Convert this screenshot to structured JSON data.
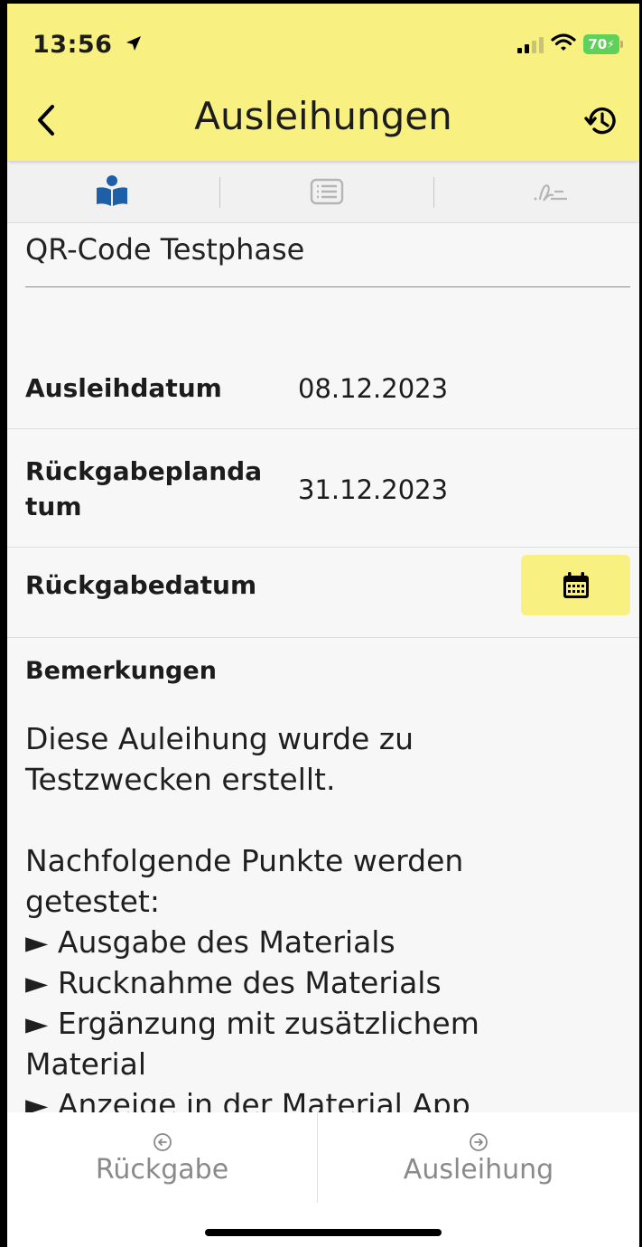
{
  "status_bar": {
    "time": "13:56",
    "battery": "70"
  },
  "header": {
    "title": "Ausleihungen"
  },
  "tabs": [
    {
      "icon": "reader-icon",
      "active": true
    },
    {
      "icon": "list-icon",
      "active": false
    },
    {
      "icon": "signature-icon",
      "active": false
    }
  ],
  "record": {
    "title": "QR-Code Testphase",
    "fields": [
      {
        "label": "Ausleihdatum",
        "value": "08.12.2023"
      },
      {
        "label": "Rückgabeplanda\ntum",
        "value": "31.12.2023"
      },
      {
        "label": "Rückgabedatum",
        "value": ""
      }
    ],
    "remarks_label": "Bemerkungen",
    "remarks_text": "Diese Auleihung wurde zu\nTestzwecken erstellt.\n\nNachfolgende Punkte werden\ngetestet:\n► Ausgabe des Materials\n► Rucknahme des Materials\n► Ergänzung mit zusätzlichem\nMaterial\n► Anzeige in der Material App"
  },
  "actions": {
    "return_label": "Rückgabe",
    "loan_label": "Ausleihung"
  },
  "colors": {
    "accent_yellow": "#f8f182",
    "active_icon": "#1f5fa8",
    "muted": "#8a8a8a"
  }
}
